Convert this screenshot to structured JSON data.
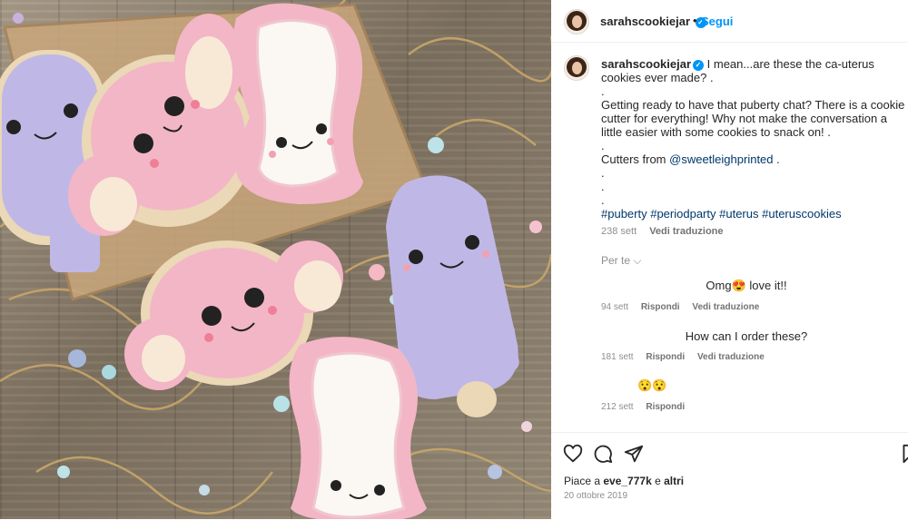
{
  "post": {
    "username": "sarahscookiejar",
    "header_dot": "•",
    "follow_label": "Segui"
  },
  "caption": {
    "username": "sarahscookiejar",
    "lines": [
      "I mean...are these the ca-uterus cookies ever made? .",
      ".",
      "Getting ready to have that puberty chat? There is a cookie cutter for everything! Why not make the conversation a little easier with some cookies to snack on! .",
      ".",
      "Cutters from",
      ".",
      ".",
      "."
    ],
    "mention": "@sweetleighprinted",
    "mention_suffix": " .",
    "hashtags": [
      "#puberty",
      "#periodparty",
      "#uterus",
      "#uteruscookies"
    ],
    "time": "238 sett",
    "translate": "Vedi traduzione"
  },
  "per_te": "Per te",
  "comments": [
    {
      "text": "Omg😍 love it!!",
      "time": "94 sett",
      "reply": "Rispondi",
      "translate": "Vedi traduzione"
    },
    {
      "text": "How can I order these?",
      "time": "181 sett",
      "reply": "Rispondi",
      "translate": "Vedi traduzione"
    },
    {
      "text": "😯😯",
      "time": "212 sett",
      "reply": "Rispondi",
      "translate": ""
    }
  ],
  "likes": {
    "prefix": "Piace a ",
    "user": "eve_777k",
    "middle": " e ",
    "others": "altri"
  },
  "date": "20 ottobre 2019",
  "icons": [
    "heart-icon",
    "comment-icon",
    "share-icon",
    "bookmark-icon",
    "verified-badge-icon"
  ],
  "colors": {
    "accent": "#0095f6",
    "link": "#00376b",
    "muted": "#8e8e8e"
  }
}
